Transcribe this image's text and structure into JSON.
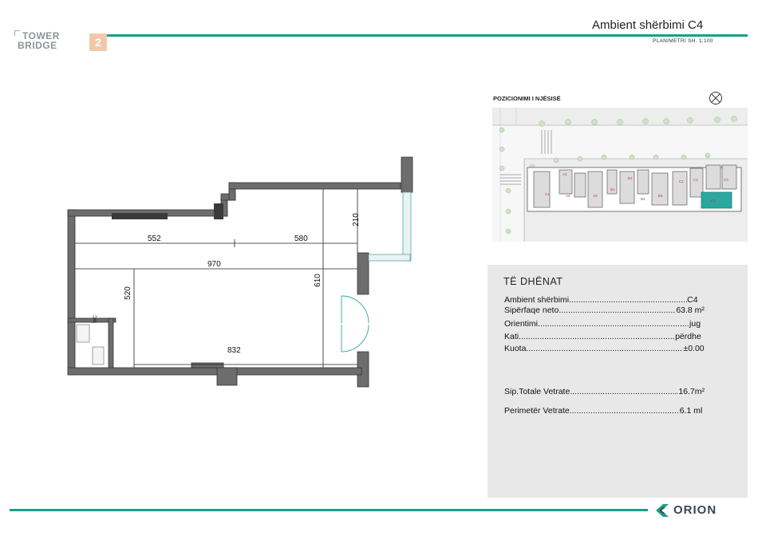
{
  "logo": {
    "line1": "TOWER",
    "line2": "BRIDGE",
    "number": "2"
  },
  "header": {
    "title": "Ambient shërbimi C4",
    "subtitle": "PLANIMETRI  SH. 1:100"
  },
  "position_section": {
    "title": "POZICIONIMI I NJËSISË",
    "compass_icon": "north-arrow-icon"
  },
  "data_section": {
    "title": "TË DHËNAT",
    "rows": [
      {
        "label": "Ambient shërbimi",
        "value": "C4"
      },
      {
        "label": "Sipërfaqe neto",
        "value": "63.8 m²"
      },
      {
        "label": "Orientimi",
        "value": "jug"
      },
      {
        "label": "Kati",
        "value": "përdhe"
      },
      {
        "label": "Kuota",
        "value": "±0.00"
      }
    ],
    "glazing_rows": [
      {
        "label": "Sip.Totale Vetrate",
        "value": "16.7m²"
      },
      {
        "label": "Perimetër Vetrate",
        "value": "6.1 ml"
      }
    ]
  },
  "plan_dimensions": {
    "d552": "552",
    "d580": "580",
    "d970": "970",
    "d210": "210",
    "d610": "610",
    "d520": "520",
    "d832": "832",
    "wc": "WC"
  },
  "site_plan_labels": [
    "A1",
    "A2",
    "A3",
    "A4",
    "B1",
    "B2",
    "B3",
    "B4",
    "C1",
    "C2",
    "C3",
    "C4"
  ],
  "brand": {
    "name": "ORION"
  },
  "colors": {
    "accent": "#1a9e8c",
    "unit_highlight": "#2aa8a0",
    "wall": "#6d6d6d"
  }
}
